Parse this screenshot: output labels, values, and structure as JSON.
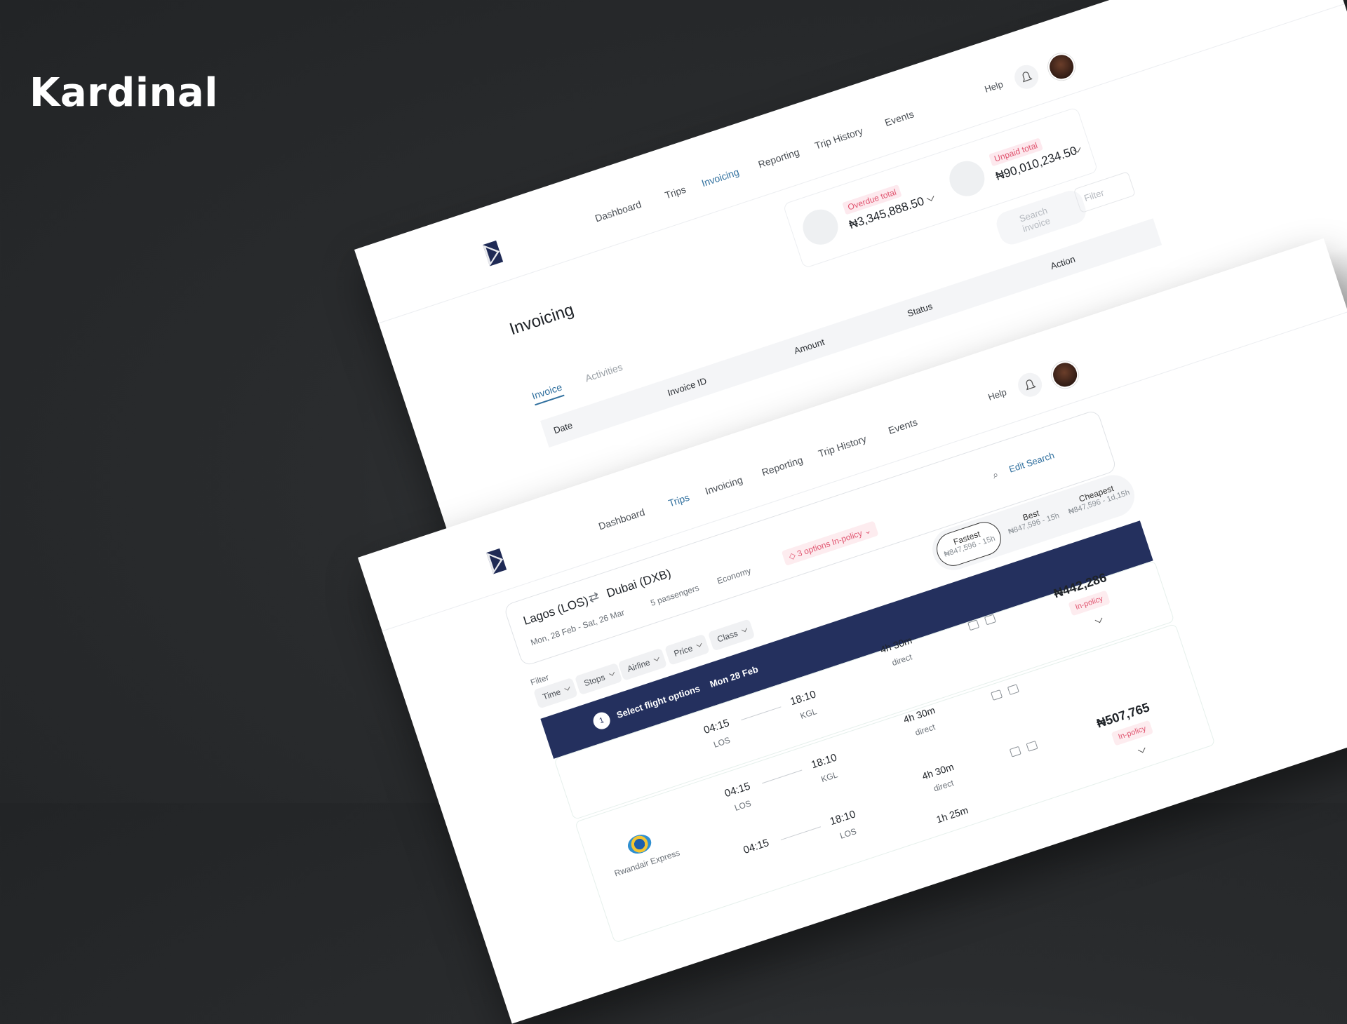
{
  "brand": {
    "title": "Kardinal"
  },
  "colors": {
    "accent": "#2f6f9e",
    "navy": "#24305e",
    "red": "#e0546f",
    "background": "#2a2c2e"
  },
  "invoicing_screen": {
    "nav": [
      "Dashboard",
      "Trips",
      "Invoicing",
      "Reporting",
      "Trip History",
      "Events"
    ],
    "active_nav": "Invoicing",
    "help": "Help",
    "page_title": "Invoicing",
    "overdue": {
      "label": "Overdue total",
      "amount": "₦3,345,888.50"
    },
    "unpaid": {
      "label": "Unpaid total",
      "amount": "₦90,010,234.50"
    },
    "search_placeholder": "Search invoice",
    "filter_label": "Filter",
    "tabs": [
      "Invoice",
      "Activities"
    ],
    "table_headers": [
      "Date",
      "Invoice ID",
      "Amount",
      "Status",
      "Action"
    ]
  },
  "trips_screen": {
    "nav": [
      "Dashboard",
      "Trips",
      "Invoicing",
      "Reporting",
      "Trip History",
      "Events"
    ],
    "active_nav": "Trips",
    "help": "Help",
    "search": {
      "origin": "Lagos (LOS)",
      "destination": "Dubai (DXB)",
      "dates": "Mon, 28 Feb - Sat, 26 Mar",
      "passengers": "5 passengers",
      "cabin": "Economy",
      "edit_label": "Edit Search"
    },
    "policy_badge": "3 options In-policy",
    "sort_options": [
      {
        "title": "Fastest",
        "sub": "₦847,596 - 15h"
      },
      {
        "title": "Best",
        "sub": "₦847,596 - 15h"
      },
      {
        "title": "Cheapest",
        "sub": "₦847,596 - 1d,15h"
      }
    ],
    "filter_label": "Filter",
    "filters": [
      "Time",
      "Stops",
      "Airline",
      "Price",
      "Class"
    ],
    "banner": {
      "step": "1",
      "text": "Select flight options",
      "date": "Mon 28 Feb"
    },
    "results": [
      {
        "airline": "",
        "leg1": {
          "dep_time": "04:15",
          "dep_code": "LOS",
          "arr_time": "18:10",
          "arr_code": "KGL",
          "duration": "4h 30m",
          "stops": "direct"
        },
        "price": "₦442,286",
        "policy": "In-policy"
      },
      {
        "airline": "Rwandair Express",
        "leg1": {
          "dep_time": "04:15",
          "dep_code": "LOS",
          "arr_time": "18:10",
          "arr_code": "KGL",
          "duration": "4h 30m",
          "stops": "direct"
        },
        "leg2": {
          "dep_time": "04:15",
          "dep_code": "",
          "arr_time": "18:10",
          "arr_code": "LOS",
          "duration": "4h 30m",
          "stops": "direct"
        },
        "leg3_duration": "1h 25m",
        "price": "₦507,765",
        "policy": "In-policy"
      }
    ]
  }
}
